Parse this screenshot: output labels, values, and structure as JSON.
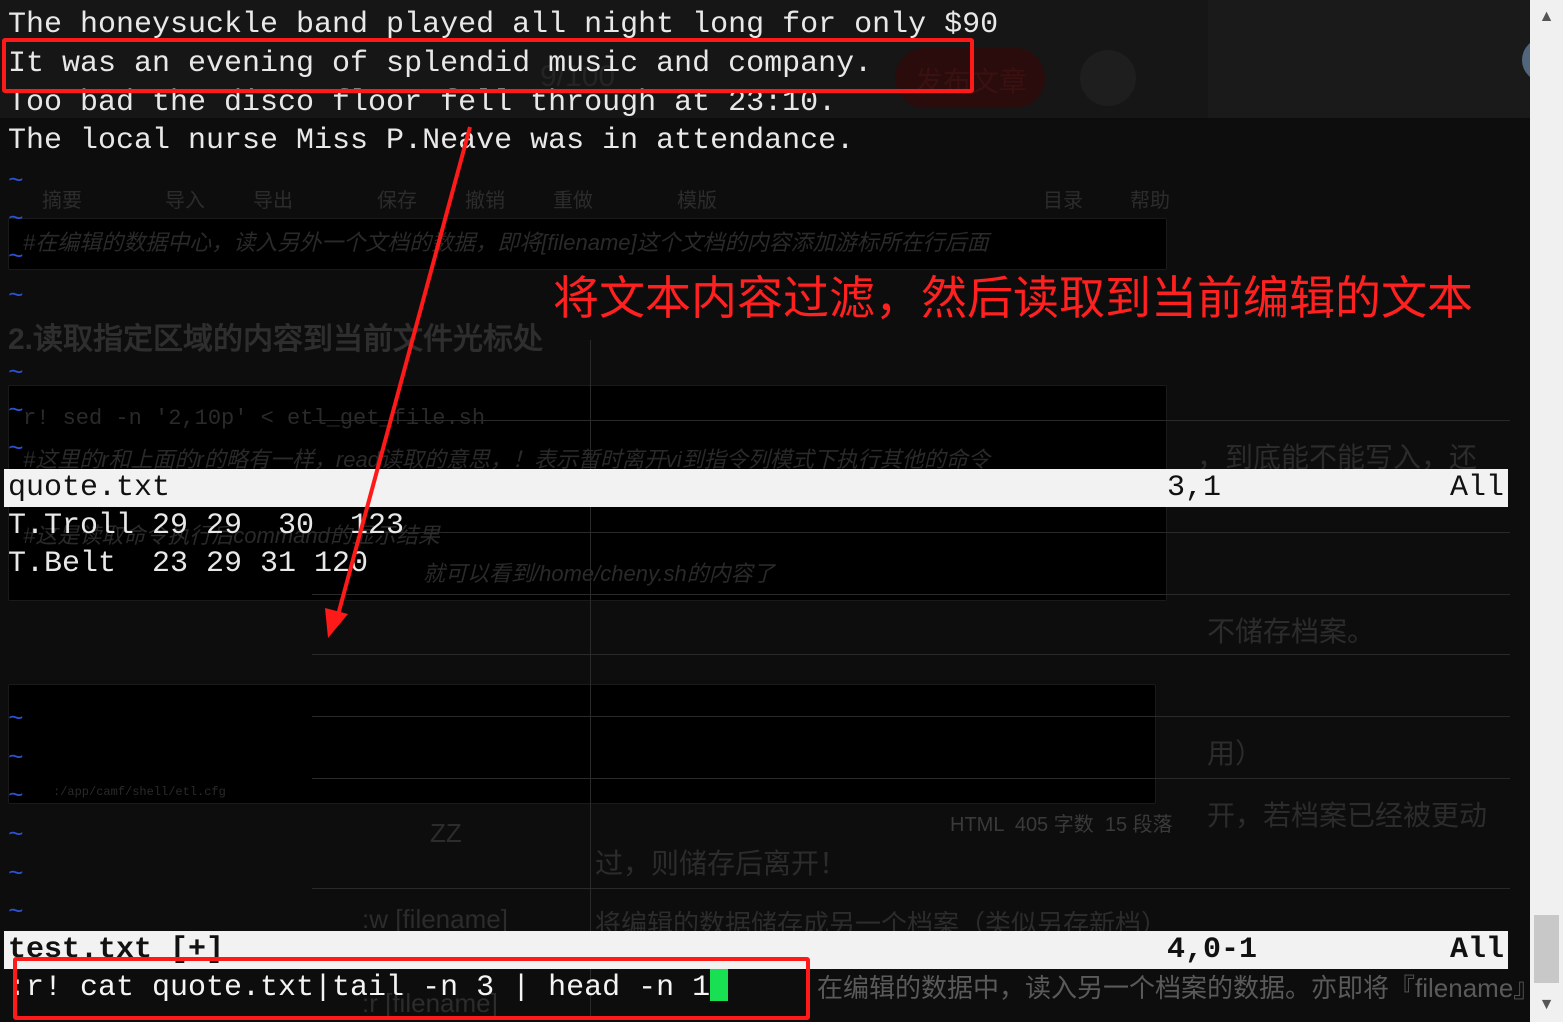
{
  "terminal": {
    "top_lines": [
      "The honeysuckle band played all night long for only $90",
      "It was an evening of splendid music and company.",
      "Too bad the disco floor fell through at 23:10.",
      "The local nurse Miss P.Neave was in attendance."
    ],
    "tilde": "~",
    "status1": {
      "name": "quote.txt",
      "position": "3,1",
      "scope": "All"
    },
    "table_lines": [
      "T.Troll 29 29  30  123",
      "T.Belt  23 29 31 120"
    ],
    "status2": {
      "name": "test.txt [+]",
      "position": "4,0-1",
      "scope": "All"
    },
    "command": ":r! cat quote.txt|tail -n 3 | head -n 1"
  },
  "annotation": {
    "text": "将文本内容过滤，然后读取到当前编辑的文本",
    "color": "#ff1a1a"
  },
  "background_ghost": {
    "toolbar": [
      "摘要",
      "导入",
      "导出",
      "保存",
      "撤销",
      "重做",
      "模版",
      "目录",
      "帮助"
    ],
    "publish_label": "发布文章",
    "count_label": "9/100",
    "heading": "2.读取指定区域的内容到当前文件光标处",
    "code1": "r! sed -n '2,10p' < etl_get_file.sh",
    "comment1": "#在编辑的数据中心，读入另外一个文档的数据，即将[filename]这个文档的内容添加游标所在行后面",
    "comment2": "#这里的r和上面的r的略有一样，read读取的意思，！表示暂时离开vi到指令列模式下执行其他的命令",
    "comment3": "#这是读取命令执行后command的显示结果",
    "comment4": "就可以看到/home/cheny.sh的内容了",
    "code2": ":/app/camf/shell/etl.cfg",
    "right_texts": [
      "，到底能不能写入，还",
      "不储存档案。",
      "用）",
      "开，若档案已经被更动",
      "过，则储存后离开！"
    ],
    "table_rows": [
      {
        "key": "ZZ",
        "desc": ""
      },
      {
        "key": ":w [filename]",
        "desc": "将编辑的数据储存成另一个档案（类似另存新档）"
      },
      {
        "key": ":r [filename]",
        "desc": "在编辑的数据中，读入另一个档案的数据。亦即将『filename』这个档"
      }
    ],
    "editor_stats": "HTML  405 字数  15 段落"
  },
  "colors": {
    "tilde": "#2d52d6",
    "cursor": "#19e052",
    "statusbar": "#f2f2f2"
  }
}
